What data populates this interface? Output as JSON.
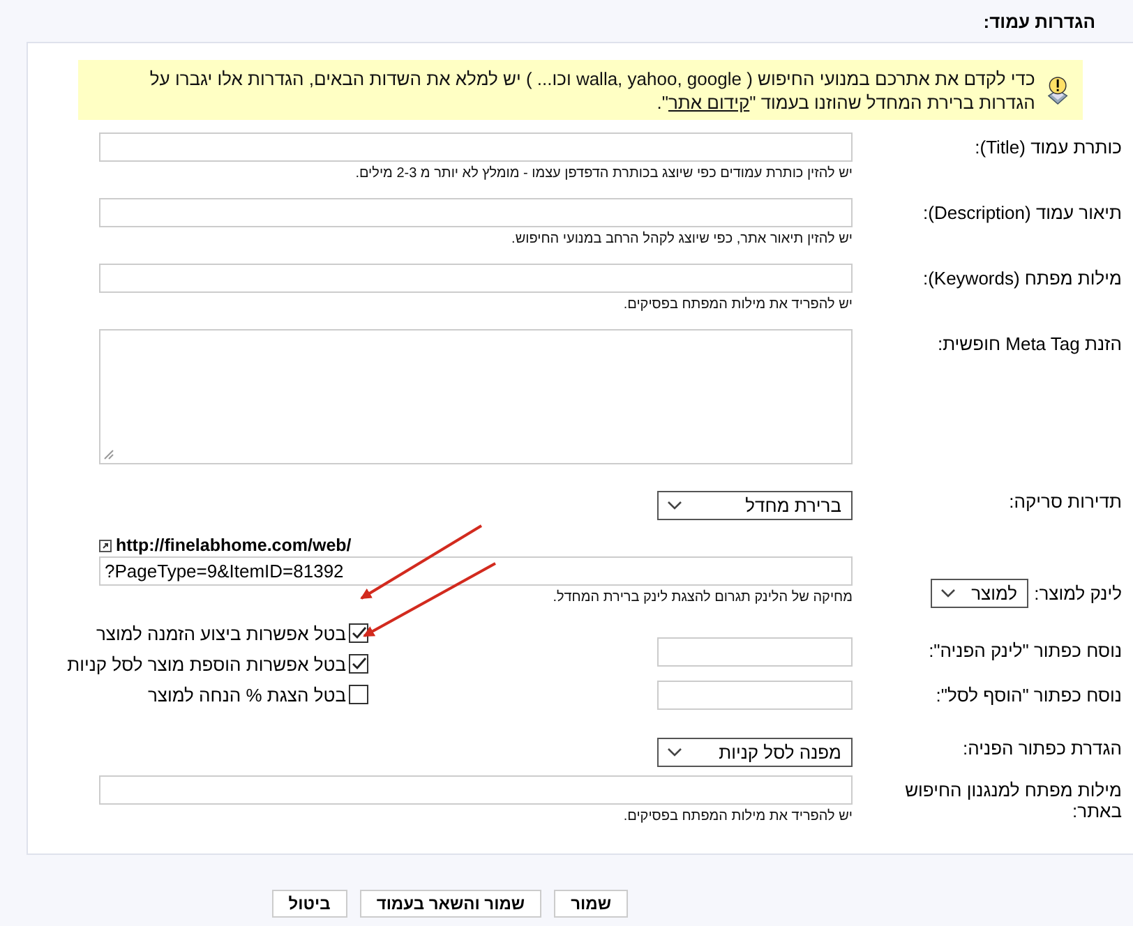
{
  "page_title": "הגדרות עמוד:",
  "notice": {
    "text": "כדי לקדם את אתרכם במנועי החיפוש ( walla, yahoo, google וכו... ) יש למלא את השדות הבאים, הגדרות אלו יגברו על הגדרות ברירת המחדל שהוזנו בעמוד \"",
    "link": "קידום אתר",
    "text_after": "\"."
  },
  "sections": [
    {
      "kind": "text",
      "label": "כותרת עמוד (Title):",
      "hint": "יש להזין כותרת עמודים כפי שיוצג בכותרת הדפדפן עצמו - מומלץ לא יותר מ 2-3 מילים."
    },
    {
      "kind": "text",
      "label": "תיאור עמוד (Description):",
      "hint": "יש להזין תיאור אתר, כפי שיוצג לקהל הרחב במנועי החיפוש."
    },
    {
      "kind": "text",
      "label": "מילות מפתח (Keywords):",
      "hint": "יש להפריד את מילות המפתח בפסיקים."
    },
    {
      "kind": "textarea",
      "label": "הזנת Meta Tag חופשית:"
    },
    {
      "kind": "select",
      "label": "תדירות סריקה:",
      "value": "ברירת מחדל"
    },
    {
      "kind": "link",
      "label": "לינק למוצר:",
      "link_type": "למוצר",
      "url": "http://finelabhome.com/web/",
      "value": "?PageType=9&ItemID=81392",
      "hint": "מחיקה של הלינק תגרום להצגת לינק ברירת המחדל."
    },
    {
      "kind": "button_texts",
      "labels": [
        "נוסח כפתור \"לינק הפניה\":",
        "נוסח כפתור \"הוסף לסל\":"
      ],
      "options": [
        {
          "label": "בטל אפשרות ביצוע הזמנה למוצר",
          "checked": true
        },
        {
          "label": "בטל אפשרות הוספת מוצר לסל קניות",
          "checked": true
        },
        {
          "label": "בטל הצגת % הנחה למוצר",
          "checked": false
        }
      ]
    },
    {
      "kind": "select",
      "label": "הגדרת כפתור הפניה:",
      "value": "מפנה לסל קניות"
    },
    {
      "kind": "text",
      "label": "מילות מפתח למנגנון החיפוש באתר:",
      "hint": "יש להפריד את מילות המפתח בפסיקים."
    }
  ],
  "buttons": [
    "שמור",
    "שמור והשאר בעמוד",
    "ביטול"
  ]
}
